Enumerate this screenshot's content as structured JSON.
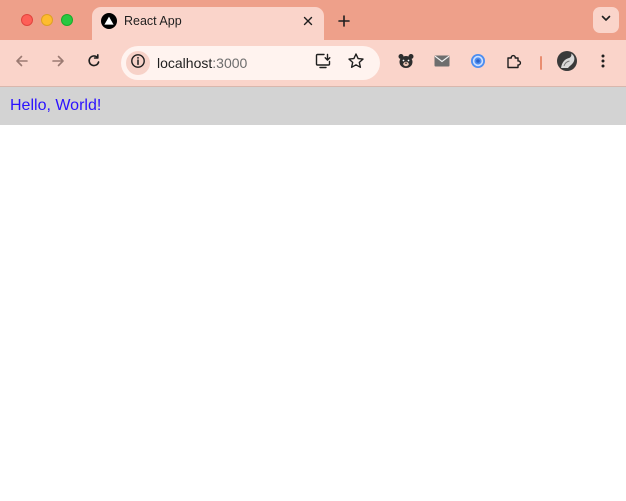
{
  "tab": {
    "title": "React App"
  },
  "address_bar": {
    "host": "localhost",
    "port": ":3000"
  },
  "app": {
    "greeting": "Hello, World!"
  },
  "icons": {
    "back": "arrow-left-icon",
    "forward": "arrow-right-icon",
    "reload": "reload-icon",
    "site_info": "info-icon",
    "install": "install-app-icon",
    "bookmark": "star-icon",
    "extensions": [
      "bear-extension-icon",
      "mail-extension-icon",
      "swirl-extension-icon",
      "puzzle-extensions-icon"
    ],
    "profile": "profile-avatar",
    "menu": "kebab-menu-icon"
  },
  "colors": {
    "tabstrip": "#eea08a",
    "toolbar": "#fad4ca",
    "app_header": "#d3d3d3",
    "greeting_text": "#2b12ff"
  }
}
